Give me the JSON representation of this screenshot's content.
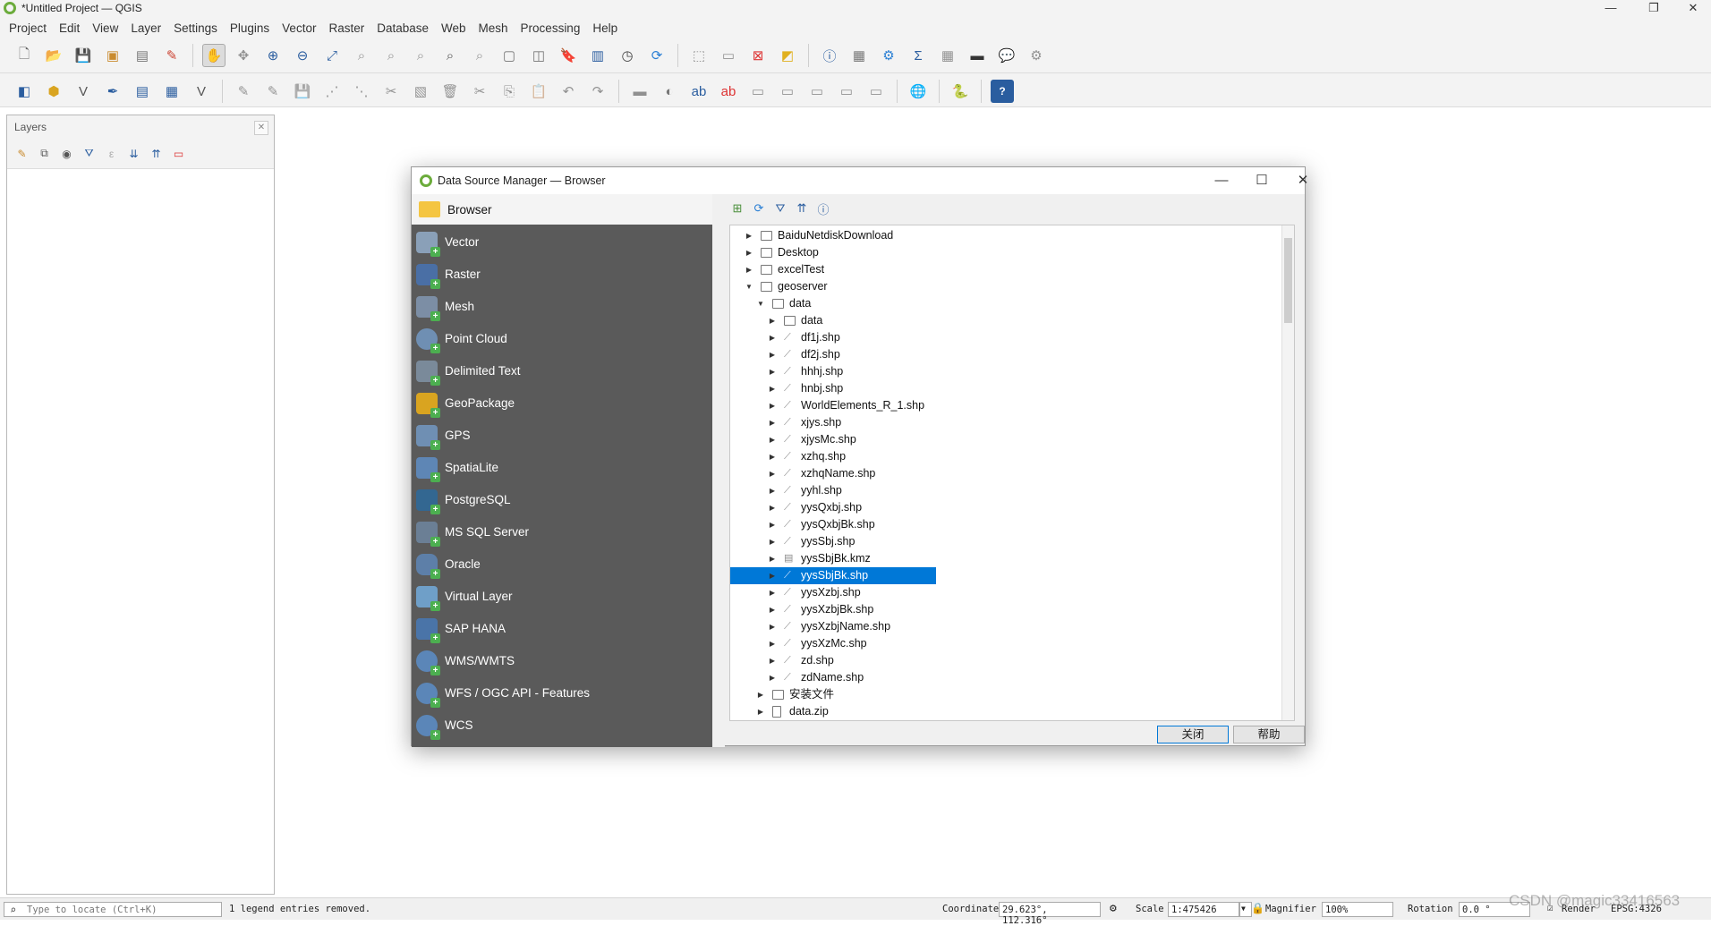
{
  "window": {
    "title": "*Untitled Project — QGIS"
  },
  "menubar": [
    "Project",
    "Edit",
    "View",
    "Layer",
    "Settings",
    "Plugins",
    "Vector",
    "Raster",
    "Database",
    "Web",
    "Mesh",
    "Processing",
    "Help"
  ],
  "layers_panel": {
    "title": "Layers"
  },
  "dialog": {
    "title": "Data Source Manager — Browser",
    "sources": [
      "Browser",
      "Vector",
      "Raster",
      "Mesh",
      "Point Cloud",
      "Delimited Text",
      "GeoPackage",
      "GPS",
      "SpatiaLite",
      "PostgreSQL",
      "MS SQL Server",
      "Oracle",
      "Virtual Layer",
      "SAP HANA",
      "WMS/WMTS",
      "WFS / OGC API - Features",
      "WCS"
    ],
    "tree": [
      {
        "label": "BaiduNetdiskDownload",
        "type": "folder",
        "level": 0,
        "expanded": false
      },
      {
        "label": "Desktop",
        "type": "folder",
        "level": 0,
        "expanded": false
      },
      {
        "label": "excelTest",
        "type": "folder",
        "level": 0,
        "expanded": false
      },
      {
        "label": "geoserver",
        "type": "folder",
        "level": 0,
        "expanded": true
      },
      {
        "label": "data",
        "type": "folder",
        "level": 1,
        "expanded": true
      },
      {
        "label": "data",
        "type": "folder",
        "level": 2,
        "expanded": false
      },
      {
        "label": "df1j.shp",
        "type": "shp",
        "level": 2,
        "expanded": false
      },
      {
        "label": "df2j.shp",
        "type": "shp",
        "level": 2,
        "expanded": false
      },
      {
        "label": "hhhj.shp",
        "type": "shp",
        "level": 2,
        "expanded": false
      },
      {
        "label": "hnbj.shp",
        "type": "shp",
        "level": 2,
        "expanded": false
      },
      {
        "label": "WorldElements_R_1.shp",
        "type": "shp",
        "level": 2,
        "expanded": false
      },
      {
        "label": "xjys.shp",
        "type": "shp",
        "level": 2,
        "expanded": false
      },
      {
        "label": "xjysMc.shp",
        "type": "shp",
        "level": 2,
        "expanded": false
      },
      {
        "label": "xzhq.shp",
        "type": "shp",
        "level": 2,
        "expanded": false
      },
      {
        "label": "xzhqName.shp",
        "type": "shp",
        "level": 2,
        "expanded": false
      },
      {
        "label": "yyhl.shp",
        "type": "shp",
        "level": 2,
        "expanded": false
      },
      {
        "label": "yysQxbj.shp",
        "type": "shp",
        "level": 2,
        "expanded": false
      },
      {
        "label": "yysQxbjBk.shp",
        "type": "shp",
        "level": 2,
        "expanded": false
      },
      {
        "label": "yysSbj.shp",
        "type": "shp",
        "level": 2,
        "expanded": false
      },
      {
        "label": "yysSbjBk.kmz",
        "type": "kmz",
        "level": 2,
        "expanded": false
      },
      {
        "label": "yysSbjBk.shp",
        "type": "shp",
        "level": 2,
        "expanded": false,
        "selected": true
      },
      {
        "label": "yysXzbj.shp",
        "type": "shp",
        "level": 2,
        "expanded": false
      },
      {
        "label": "yysXzbjBk.shp",
        "type": "shp",
        "level": 2,
        "expanded": false
      },
      {
        "label": "yysXzbjName.shp",
        "type": "shp",
        "level": 2,
        "expanded": false
      },
      {
        "label": "yysXzMc.shp",
        "type": "shp",
        "level": 2,
        "expanded": false
      },
      {
        "label": "zd.shp",
        "type": "shp",
        "level": 2,
        "expanded": false
      },
      {
        "label": "zdName.shp",
        "type": "shp",
        "level": 2,
        "expanded": false
      },
      {
        "label": "安装文件",
        "type": "folder",
        "level": 1,
        "expanded": false
      },
      {
        "label": "data.zip",
        "type": "zip",
        "level": 1,
        "expanded": false
      }
    ],
    "close_label": "关闭",
    "help_label": "帮助"
  },
  "statusbar": {
    "locate_placeholder": "Type to locate (Ctrl+K)",
    "message": "1 legend entries removed.",
    "coordinate_label": "Coordinate",
    "coordinate_value": "29.623°, 112.316°",
    "scale_label": "Scale",
    "scale_value": "1:475426",
    "magnifier_label": "Magnifier",
    "magnifier_value": "100%",
    "rotation_label": "Rotation",
    "rotation_value": "0.0 °",
    "render_label": "Render",
    "crs_label": "EPSG:4326"
  },
  "watermark": "CSDN @magic33416563"
}
